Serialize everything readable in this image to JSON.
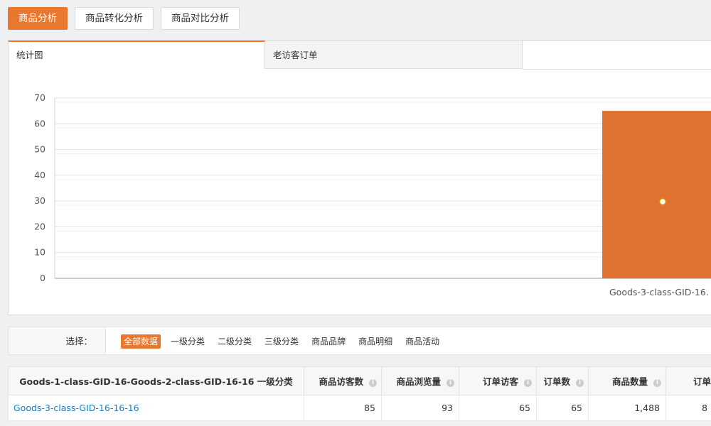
{
  "top_tabs": [
    "商品分析",
    "商品转化分析",
    "商品对比分析"
  ],
  "sub_tabs": [
    "统计图",
    "老访客订单"
  ],
  "chart_data": {
    "type": "bar",
    "categories": [
      "Goods-3-class-GID-16."
    ],
    "values": [
      65
    ],
    "ylim": [
      0,
      70
    ],
    "yticks": [
      0,
      10,
      20,
      30,
      40,
      50,
      60,
      70
    ],
    "grid": true,
    "bar_color": "#e07331",
    "title": "",
    "xlabel": "",
    "ylabel": ""
  },
  "filter": {
    "label": "选择：",
    "options": [
      "全部数据",
      "一级分类",
      "二级分类",
      "三级分类",
      "商品品牌",
      "商品明细",
      "商品活动"
    ],
    "selected": "全部数据"
  },
  "table": {
    "headers": [
      "Goods-1-class-GID-16-Goods-2-class-GID-16-16 一级分类",
      "商品访客数",
      "商品浏览量",
      "订单访客",
      "订单数",
      "商品数量",
      "订单金"
    ],
    "rows": [
      [
        "Goods-3-class-GID-16-16-16",
        "85",
        "93",
        "65",
        "65",
        "1,488",
        "8"
      ]
    ]
  },
  "colors": {
    "accent": "#e8782f",
    "link": "#1a7fc1"
  }
}
